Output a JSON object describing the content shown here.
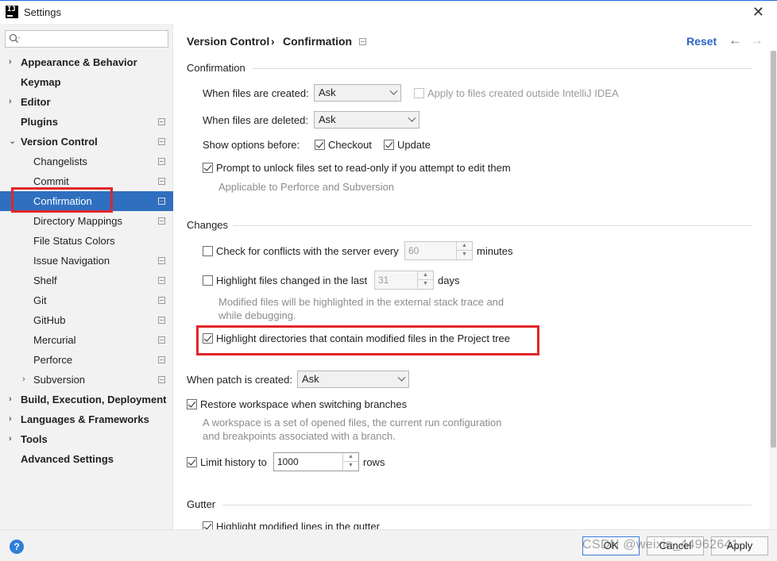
{
  "window": {
    "title": "Settings",
    "app_icon": "IJ"
  },
  "search": {
    "placeholder": ""
  },
  "sidebar": {
    "items": [
      {
        "label": "Appearance & Behavior"
      },
      {
        "label": "Keymap"
      },
      {
        "label": "Editor"
      },
      {
        "label": "Plugins"
      },
      {
        "label": "Version Control"
      },
      {
        "label": "Changelists"
      },
      {
        "label": "Commit"
      },
      {
        "label": "Confirmation"
      },
      {
        "label": "Directory Mappings"
      },
      {
        "label": "File Status Colors"
      },
      {
        "label": "Issue Navigation"
      },
      {
        "label": "Shelf"
      },
      {
        "label": "Git"
      },
      {
        "label": "GitHub"
      },
      {
        "label": "Mercurial"
      },
      {
        "label": "Perforce"
      },
      {
        "label": "Subversion"
      },
      {
        "label": "Build, Execution, Deployment"
      },
      {
        "label": "Languages & Frameworks"
      },
      {
        "label": "Tools"
      },
      {
        "label": "Advanced Settings"
      }
    ],
    "selected": "Confirmation"
  },
  "header": {
    "breadcrumb_parent": "Version Control",
    "breadcrumb_sep": "›",
    "breadcrumb_current": "Confirmation",
    "reset_label": "Reset",
    "back_arrow": "←",
    "forward_arrow": "→"
  },
  "confirmation": {
    "section_title": "Confirmation",
    "files_created_label": "When files are created:",
    "files_created_value": "Ask",
    "apply_outside_label": "Apply to files created outside IntelliJ IDEA",
    "files_deleted_label": "When files are deleted:",
    "files_deleted_value": "Ask",
    "show_options_label": "Show options before:",
    "checkout_label": "Checkout",
    "update_label": "Update",
    "prompt_unlock_label": "Prompt to unlock files set to read-only if you attempt to edit them",
    "prompt_unlock_hint": "Applicable to Perforce and Subversion"
  },
  "changes": {
    "section_title": "Changes",
    "conflicts_label": "Check for conflicts with the server every",
    "conflicts_value": "60",
    "conflicts_unit": "minutes",
    "highlight_changed_label": "Highlight files changed in the last",
    "highlight_changed_value": "31",
    "highlight_changed_unit": "days",
    "highlight_changed_hint_1": "Modified files will be highlighted in the external stack trace and",
    "highlight_changed_hint_2": "while debugging.",
    "highlight_dirs_label": "Highlight directories that contain modified files in the Project tree"
  },
  "patch": {
    "label": "When patch is created:",
    "value": "Ask",
    "restore_label": "Restore workspace when switching branches",
    "restore_hint_1": "A workspace is a set of opened files, the current run configuration",
    "restore_hint_2": "and breakpoints associated with a branch.",
    "limit_label": "Limit history to",
    "limit_value": "1000",
    "limit_unit": "rows"
  },
  "gutter": {
    "section_title": "Gutter",
    "highlight_lines_label": "Highlight modified lines in the gutter"
  },
  "footer": {
    "help_label": "?",
    "ok_label": "OK",
    "cancel_label": "Cancel",
    "apply_label": "Apply",
    "watermark": "CSDN @weixin_44962641"
  },
  "colors": {
    "selection": "#2f6fbf",
    "highlight_box": "#e0262a",
    "link": "#2a66c6"
  }
}
